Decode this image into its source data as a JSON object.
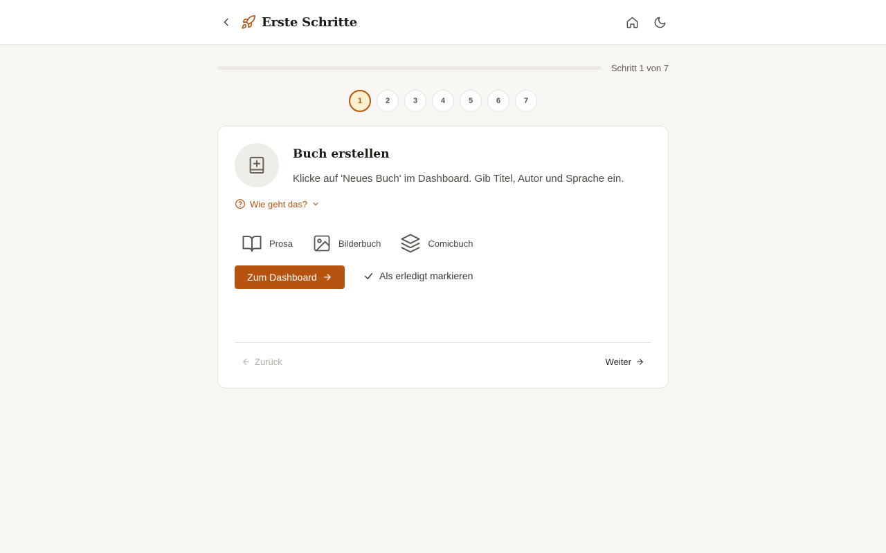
{
  "header": {
    "title": "Erste Schritte",
    "back_icon": "chevron-left-icon",
    "rocket_icon": "rocket-icon",
    "home_icon": "home-icon",
    "theme_icon": "moon-icon"
  },
  "progress": {
    "label": "Schritt 1 von 7",
    "fraction": 0.0
  },
  "steps": [
    "1",
    "2",
    "3",
    "4",
    "5",
    "6",
    "7"
  ],
  "active_step": "1",
  "card": {
    "icon": "book-plus-icon",
    "title": "Buch erstellen",
    "description": "Klicke auf 'Neues Buch' im Dashboard. Gib Titel, Autor und Sprache ein.",
    "howto_label": "Wie geht das?",
    "types": [
      {
        "label": "Prosa",
        "icon": "open-book-icon"
      },
      {
        "label": "Bilderbuch",
        "icon": "image-icon"
      },
      {
        "label": "Comicbuch",
        "icon": "layers-icon"
      }
    ],
    "primary_label": "Zum Dashboard",
    "mark_done_label": "Als erledigt markieren",
    "prev_label": "Zurück",
    "next_label": "Weiter"
  },
  "colors": {
    "accent": "#b5530f",
    "active_step_bg": "#fdf0cf",
    "background": "#f8f7f4"
  }
}
